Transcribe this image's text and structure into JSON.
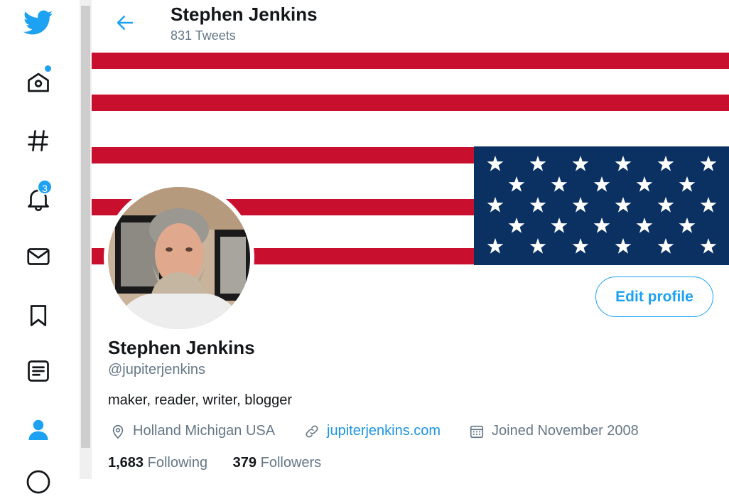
{
  "nav": {
    "items": [
      "twitter-logo",
      "home-icon",
      "explore-icon",
      "notifications-icon",
      "messages-icon",
      "bookmarks-icon",
      "lists-icon",
      "profile-icon",
      "more-icon"
    ],
    "notifications_count": "3"
  },
  "header": {
    "title": "Stephen Jenkins",
    "tweet_count": "831 Tweets"
  },
  "profile": {
    "name": "Stephen Jenkins",
    "handle": "@jupiterjenkins",
    "bio": "maker, reader, writer, blogger",
    "location": "Holland Michigan USA",
    "website": "jupiterjenkins.com",
    "joined": "Joined November 2008",
    "following_count": "1,683",
    "following_label": "Following",
    "followers_count": "379",
    "followers_label": "Followers",
    "edit_label": "Edit profile"
  },
  "colors": {
    "accent": "#1da1f2",
    "flag_red": "#c8102e",
    "flag_blue": "#0a3161"
  }
}
